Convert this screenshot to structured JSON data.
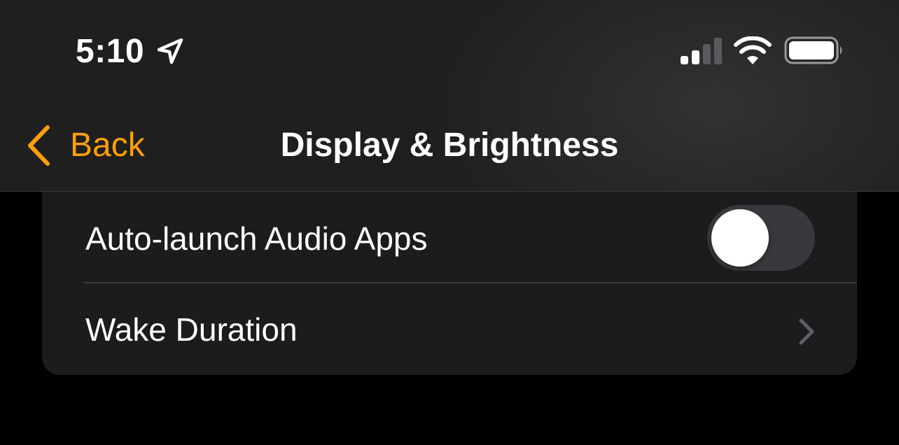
{
  "status_bar": {
    "time": "5:10",
    "icons": [
      "location-arrow-icon",
      "cellular-signal-icon",
      "wifi-icon",
      "battery-icon"
    ]
  },
  "nav": {
    "back_label": "Back",
    "title": "Display & Brightness"
  },
  "settings": {
    "rows": [
      {
        "label": "Auto-launch Audio Apps",
        "control": "toggle",
        "toggle_on": false
      },
      {
        "label": "Wake Duration",
        "control": "disclosure-chevron"
      }
    ]
  },
  "colors": {
    "accent": "#ff9f0a",
    "background": "#000000",
    "group_background": "#1c1c1e",
    "toggle_off_track": "#39393d"
  }
}
